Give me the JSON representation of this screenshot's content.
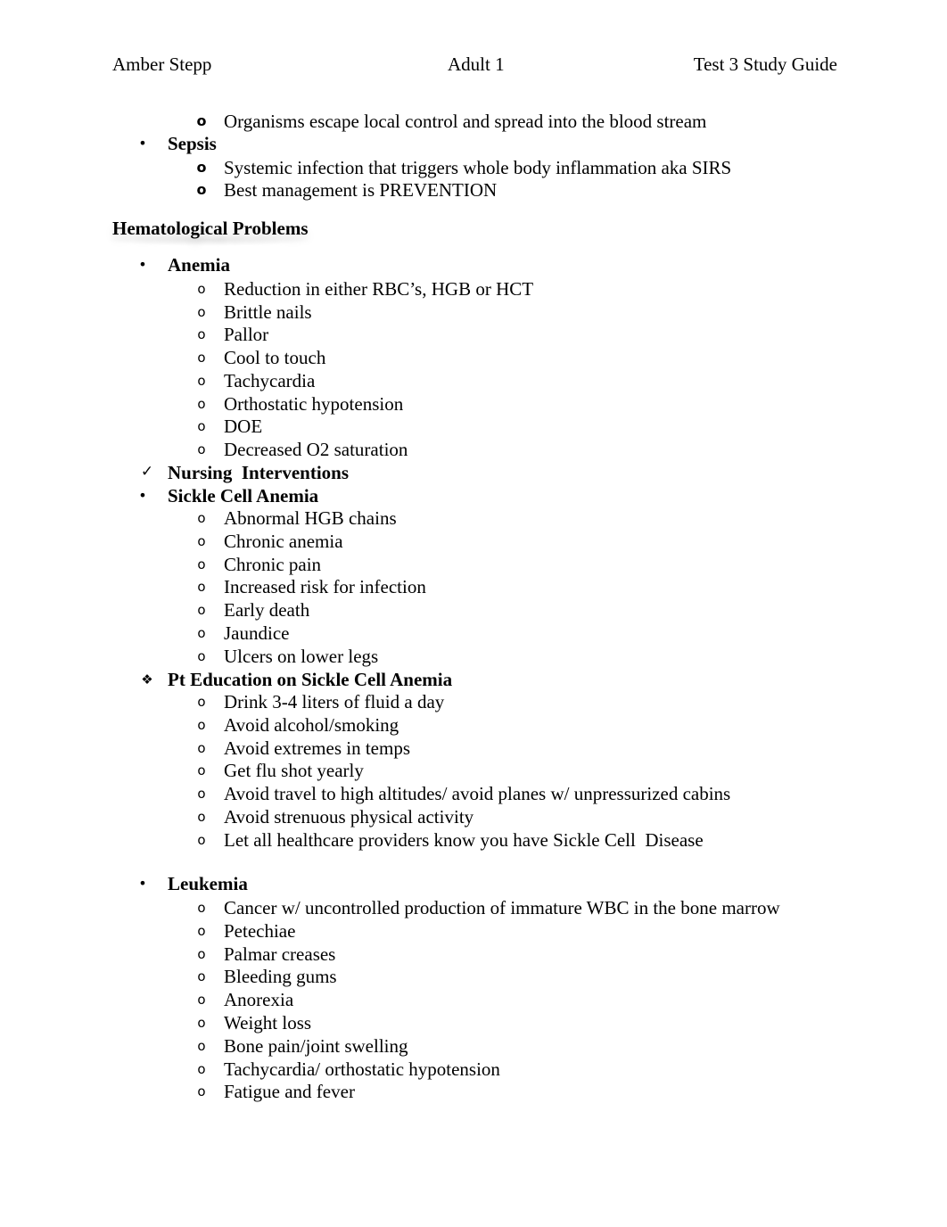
{
  "header": {
    "author": "Amber Stepp",
    "course": "Adult 1",
    "title": "Test 3 Study Guide"
  },
  "top_section": {
    "continued_item": "Organisms escape local control and spread into the blood stream",
    "sepsis": {
      "label": "Sepsis",
      "items": [
        "Systemic infection that triggers whole body inflammation aka SIRS",
        "Best management is PREVENTION"
      ]
    }
  },
  "section_title": "Hematological Problems",
  "anemia": {
    "label": "Anemia",
    "items": [
      "Reduction in either RBC’s, HGB or HCT",
      "Brittle nails",
      "Pallor",
      "Cool to touch",
      "Tachycardia",
      "Orthostatic hypotension",
      "DOE",
      "Decreased O2 saturation"
    ]
  },
  "nursing_interventions": {
    "label": "Nursing  Interventions"
  },
  "sickle_cell": {
    "label": "Sickle Cell Anemia",
    "items": [
      "Abnormal HGB chains",
      "Chronic anemia",
      "Chronic pain",
      "Increased risk for infection",
      "Early death",
      "Jaundice",
      "Ulcers on lower legs"
    ]
  },
  "pt_education": {
    "label": "Pt Education on Sickle Cell Anemia",
    "items": [
      "Drink 3-4 liters of fluid a day",
      "Avoid alcohol/smoking",
      "Avoid extremes in temps",
      "Get flu shot yearly",
      "Avoid travel to high altitudes/ avoid planes w/ unpressurized cabins",
      "Avoid strenuous physical activity",
      "Let all healthcare providers know you have Sickle Cell  Disease"
    ]
  },
  "leukemia": {
    "label": "Leukemia",
    "items": [
      "Cancer w/ uncontrolled production of immature WBC in the bone marrow",
      "Petechiae",
      "Palmar creases",
      "Bleeding gums",
      "Anorexia",
      "Weight loss",
      "Bone pain/joint swelling",
      "Tachycardia/ orthostatic hypotension",
      "Fatigue and fever"
    ]
  },
  "icons": {
    "bullet": "•",
    "sub_bullet": "o",
    "check": "✓",
    "diamond": "❖"
  }
}
